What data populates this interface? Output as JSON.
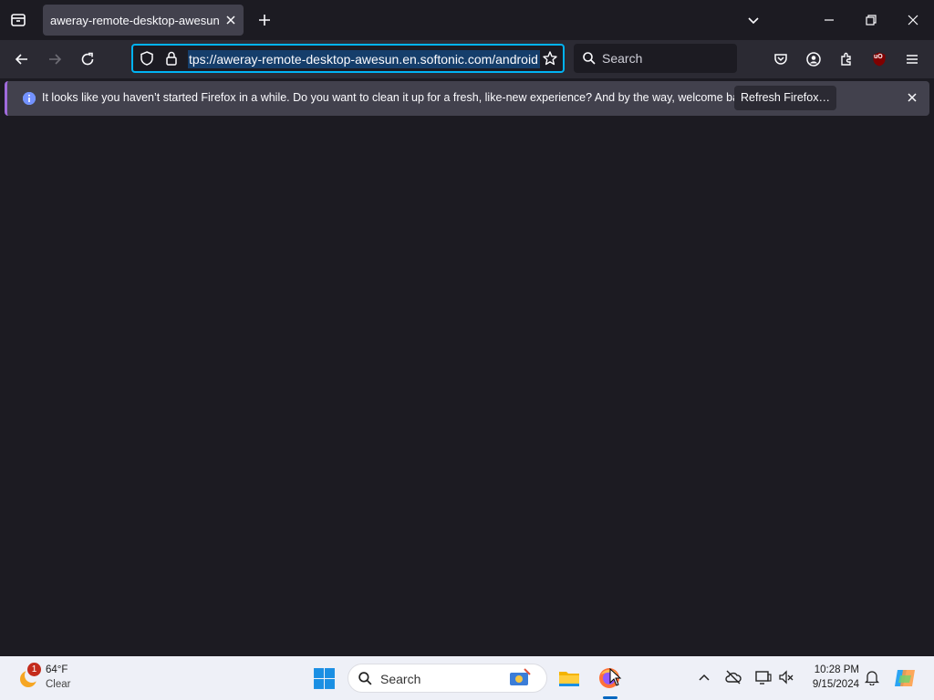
{
  "browser": {
    "tab": {
      "title": "aweray-remote-desktop-awesun.en.softonic.com"
    },
    "url": "tps://aweray-remote-desktop-awesun.en.softonic.com/android",
    "search_placeholder": "Search",
    "notification": {
      "text": "It looks like you haven’t started Firefox in a while. Do you want to clean it up for a fresh, like-new experience? And by the way, welcome back!",
      "button_label": "Refresh Firefox…"
    },
    "extension_badge": "uO"
  },
  "taskbar": {
    "weather": {
      "badge": "1",
      "temp": "64°F",
      "condition": "Clear"
    },
    "search_label": "Search",
    "clock": {
      "time": "10:28 PM",
      "date": "9/15/2024"
    }
  }
}
